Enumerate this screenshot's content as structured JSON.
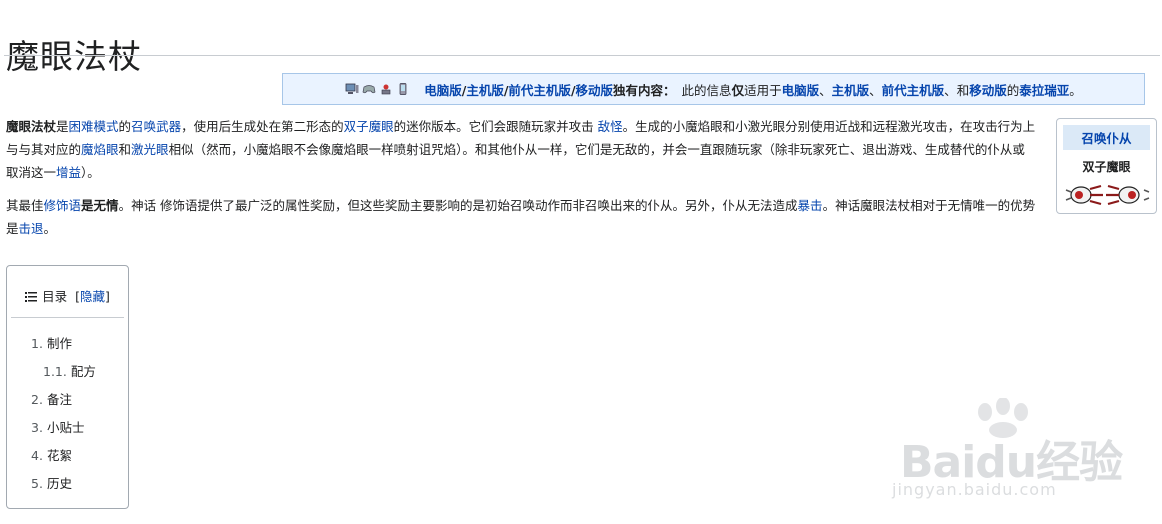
{
  "title": "魔眼法杖",
  "notice": {
    "version_links": [
      "电脑版",
      "主机版",
      "前代主机版",
      "移动版"
    ],
    "exclusive_label": "独有内容：",
    "info_pre": "此的信息",
    "only": "仅",
    "info_applies": "适用于",
    "applies_links": [
      "电脑版",
      "主机版",
      "前代主机版"
    ],
    "and": "和",
    "mobile": "移动版",
    "of": "的",
    "game": "泰拉瑞亚",
    "period": "。"
  },
  "infobox": {
    "header": "召唤仆从",
    "name": "双子魔眼"
  },
  "para1": {
    "bold_title": "魔眼法杖",
    "t1": "是",
    "l1": "困难模式",
    "t2": "的",
    "l2": "召唤武器",
    "t3": "，使用后生成处在第二形态的",
    "l3": "双子魔眼",
    "t4": "的迷你版本。它们会跟随玩家并攻击",
    "l4": "敌怪",
    "t5": "。生成的小魔焰眼和小激光眼分别使用近战和远程激光攻击，在攻击行为上与与其对应的",
    "l5": "魔焰眼",
    "t6": "和",
    "l6": "激光眼",
    "t7": "相似（然而，小魔焰眼不会像魔焰眼一样喷射诅咒焰）。和其他仆从一样，它们是无敌的，并会一直跟随玩家（除非玩家死亡、退出游戏、生成替代的仆从或取消这一",
    "l7": "增益",
    "t8": "）。"
  },
  "para2": {
    "t1": "其最佳",
    "l1": "修饰语",
    "t2": "是",
    "b1": "无情",
    "t3": "。神话 修饰语提供了最广泛的属性奖励，但这些奖励主要影响的是初始召唤动作而非召唤出来的仆从。另外，仆从无法造成",
    "l2": "暴击",
    "t4": "。神话魔眼法杖相对于无情唯一的优势是",
    "l3": "击退",
    "t5": "。"
  },
  "toc": {
    "icon": "list-icon",
    "title": "目录",
    "toggle": "隐藏",
    "items": [
      {
        "num": "1.",
        "label": "制作"
      },
      {
        "num": "1.1.",
        "label": "配方"
      },
      {
        "num": "2.",
        "label": "备注"
      },
      {
        "num": "3.",
        "label": "小贴士"
      },
      {
        "num": "4.",
        "label": "花絮"
      },
      {
        "num": "5.",
        "label": "历史"
      }
    ]
  },
  "watermark": {
    "brand": "Baidu经验",
    "url": "jingyan.baidu.com"
  },
  "colors": {
    "link": "#0645ad",
    "notice_bg": "#eaf3ff",
    "infobox_header_bg": "#dbe9f7"
  }
}
